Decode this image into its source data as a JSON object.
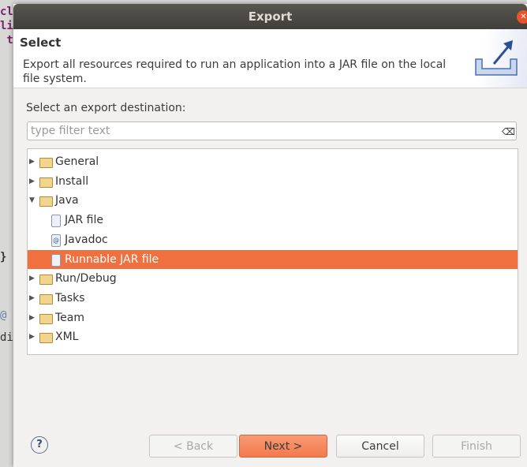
{
  "background": {
    "fragments": [
      "cla",
      "lic",
      " tr",
      "}",
      "@",
      "di"
    ]
  },
  "dialog": {
    "title": "Export",
    "header": {
      "title": "Select",
      "description": "Export all resources required to run an application into a JAR file on the local file system."
    },
    "destination_label": "Select an export destination:",
    "filter": {
      "value": "",
      "placeholder": "type filter text",
      "clear_icon": "⌫"
    },
    "tree": [
      {
        "label": "General",
        "type": "folder",
        "expanded": false
      },
      {
        "label": "Install",
        "type": "folder",
        "expanded": false
      },
      {
        "label": "Java",
        "type": "folder",
        "expanded": true
      },
      {
        "label": "JAR file",
        "type": "item"
      },
      {
        "label": "Javadoc",
        "type": "item"
      },
      {
        "label": "Runnable JAR file",
        "type": "item",
        "selected": true
      },
      {
        "label": "Run/Debug",
        "type": "folder",
        "expanded": false
      },
      {
        "label": "Tasks",
        "type": "folder",
        "expanded": false
      },
      {
        "label": "Team",
        "type": "folder",
        "expanded": false
      },
      {
        "label": "XML",
        "type": "folder",
        "expanded": false
      }
    ],
    "buttons": {
      "help": "?",
      "back": "< Back",
      "next": "Next >",
      "cancel": "Cancel",
      "finish": "Finish"
    },
    "accent": "#f0703f"
  }
}
